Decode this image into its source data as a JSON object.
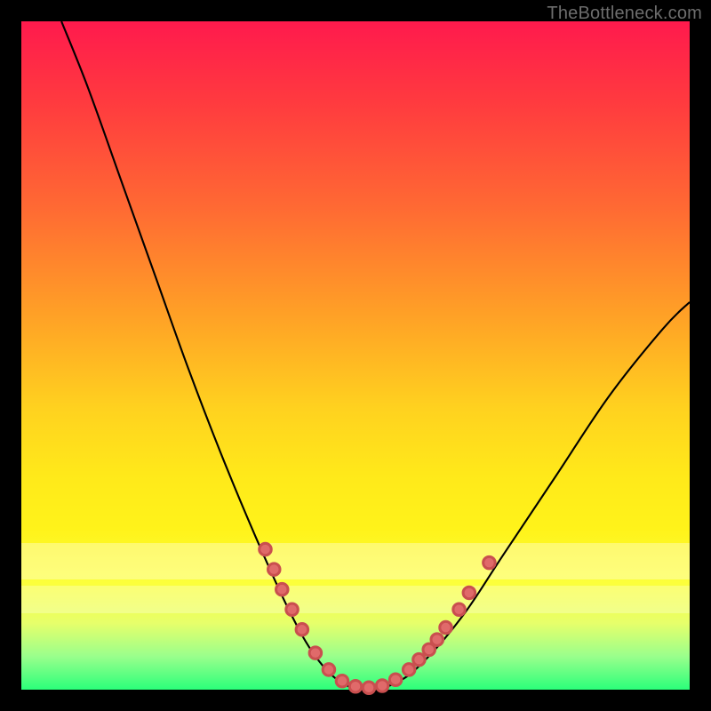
{
  "attribution": "TheBottleneck.com",
  "chart_data": {
    "type": "line",
    "title": "",
    "xlabel": "",
    "ylabel": "",
    "xlim": [
      0,
      100
    ],
    "ylim": [
      0,
      100
    ],
    "grid": false,
    "legend": false,
    "curve_color": "#000000",
    "curve": [
      {
        "x": 6,
        "y": 100
      },
      {
        "x": 10,
        "y": 90
      },
      {
        "x": 15,
        "y": 76
      },
      {
        "x": 20,
        "y": 62
      },
      {
        "x": 25,
        "y": 48
      },
      {
        "x": 30,
        "y": 35
      },
      {
        "x": 35,
        "y": 23
      },
      {
        "x": 40,
        "y": 12
      },
      {
        "x": 44,
        "y": 5
      },
      {
        "x": 48,
        "y": 1
      },
      {
        "x": 52,
        "y": 0
      },
      {
        "x": 56,
        "y": 1
      },
      {
        "x": 60,
        "y": 4
      },
      {
        "x": 66,
        "y": 11
      },
      {
        "x": 72,
        "y": 20
      },
      {
        "x": 80,
        "y": 32
      },
      {
        "x": 88,
        "y": 44
      },
      {
        "x": 96,
        "y": 54
      },
      {
        "x": 100,
        "y": 58
      }
    ],
    "points": [
      {
        "x": 36.5,
        "y": 21
      },
      {
        "x": 37.8,
        "y": 18
      },
      {
        "x": 39,
        "y": 15
      },
      {
        "x": 40.5,
        "y": 12
      },
      {
        "x": 42,
        "y": 9
      },
      {
        "x": 44,
        "y": 5.5
      },
      {
        "x": 46,
        "y": 3
      },
      {
        "x": 48,
        "y": 1.3
      },
      {
        "x": 50,
        "y": 0.5
      },
      {
        "x": 52,
        "y": 0.3
      },
      {
        "x": 54,
        "y": 0.6
      },
      {
        "x": 56,
        "y": 1.5
      },
      {
        "x": 58,
        "y": 3
      },
      {
        "x": 59.5,
        "y": 4.5
      },
      {
        "x": 61,
        "y": 6
      },
      {
        "x": 62.2,
        "y": 7.5
      },
      {
        "x": 63.5,
        "y": 9.3
      },
      {
        "x": 65.5,
        "y": 12
      },
      {
        "x": 67,
        "y": 14.5
      },
      {
        "x": 70,
        "y": 19
      }
    ]
  }
}
